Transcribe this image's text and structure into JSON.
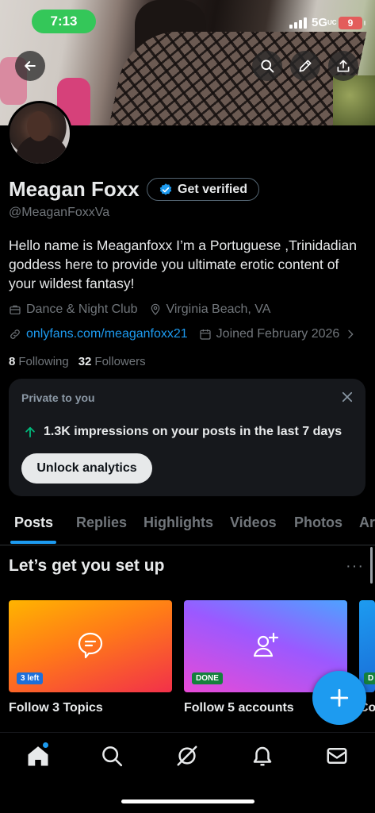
{
  "status_bar": {
    "time": "7:13",
    "network": "5G",
    "network_badge": "UC",
    "battery": "9"
  },
  "header": {
    "back_icon": "arrow-left-icon",
    "actions": [
      "search-icon",
      "edit-icon",
      "share-icon"
    ]
  },
  "profile": {
    "name": "Meagan Foxx",
    "verify_label": "Get verified",
    "handle": "@MeaganFoxxVa",
    "bio": "Hello name is Meaganfoxx I’m a Portuguese ,Trinidadian goddess here to provide you ultimate erotic content of your wildest fantasy!",
    "category": "Dance & Night Club",
    "location": "Virginia Beach, VA",
    "website": "onlyfans.com/meaganfoxx21",
    "joined": "Joined February 2026",
    "following_count": "8",
    "following_label": "Following",
    "followers_count": "32",
    "followers_label": "Followers"
  },
  "private_card": {
    "title": "Private to you",
    "impressions_text": "1.3K impressions on your posts in the last 7 days",
    "unlock_label": "Unlock analytics"
  },
  "tabs": [
    {
      "label": "Posts",
      "active": true
    },
    {
      "label": "Replies",
      "active": false
    },
    {
      "label": "Highlights",
      "active": false
    },
    {
      "label": "Videos",
      "active": false
    },
    {
      "label": "Photos",
      "active": false
    },
    {
      "label": "Ar",
      "active": false
    }
  ],
  "setup": {
    "title": "Let’s get you set up",
    "more": "···",
    "cards": [
      {
        "label": "Follow 3 Topics",
        "badge": "3 left",
        "icon": "topic-bubble-icon"
      },
      {
        "label": "Follow 5 accounts",
        "badge": "DONE",
        "icon": "add-user-icon"
      },
      {
        "label": "Co",
        "badge": "D",
        "icon": ""
      }
    ]
  },
  "bottom_nav": [
    "home-icon",
    "search-icon",
    "grok-icon",
    "notifications-icon",
    "messages-icon"
  ],
  "colors": {
    "accent": "#1d9bf0",
    "time_pill": "#34c759",
    "battery": "#e35d5b",
    "background": "#000000"
  }
}
